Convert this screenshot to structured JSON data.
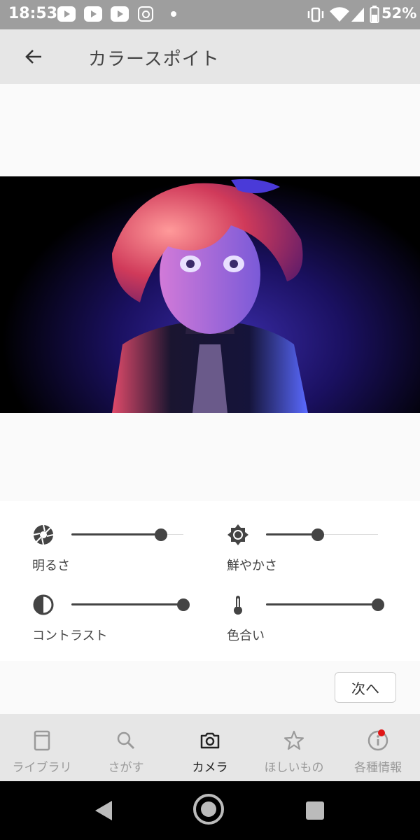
{
  "status_bar": {
    "time": "18:53",
    "battery": "52%"
  },
  "app_bar": {
    "back_icon": "arrow-left-icon",
    "title": "カラースポイト"
  },
  "adjustments": [
    {
      "label": "明るさ",
      "icon": "aperture-icon",
      "value": 0.8
    },
    {
      "label": "鮮やかさ",
      "icon": "brightness-icon",
      "value": 0.46
    },
    {
      "label": "コントラスト",
      "icon": "contrast-icon",
      "value": 1.0
    },
    {
      "label": "色合い",
      "icon": "thermometer-icon",
      "value": 1.0
    }
  ],
  "next_button": "次へ",
  "bottom_nav": [
    {
      "label": "ライブラリ",
      "icon": "book-icon",
      "active": false
    },
    {
      "label": "さがす",
      "icon": "search-icon",
      "active": false
    },
    {
      "label": "カメラ",
      "icon": "camera-icon",
      "active": true
    },
    {
      "label": "ほしいもの",
      "icon": "star-icon",
      "active": false
    },
    {
      "label": "各種情報",
      "icon": "info-icon",
      "active": false
    }
  ],
  "colors": {
    "status_bar_bg": "#9e9e9e",
    "app_bar_bg": "#e6e6e6",
    "slider": "#444444",
    "badge": "#e01515"
  }
}
